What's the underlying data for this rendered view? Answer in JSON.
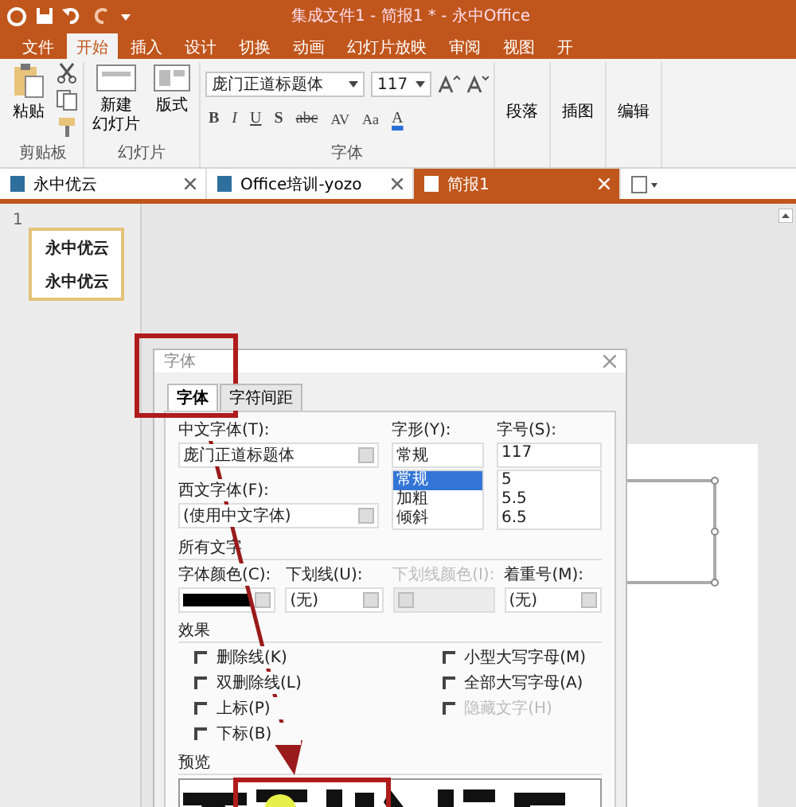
{
  "window": {
    "title": "集成文件1 - 简报1 * - 永中Office"
  },
  "ribbon_tabs": [
    {
      "label": "文件",
      "selected": false
    },
    {
      "label": "开始",
      "selected": true
    },
    {
      "label": "插入",
      "selected": false
    },
    {
      "label": "设计",
      "selected": false
    },
    {
      "label": "切换",
      "selected": false
    },
    {
      "label": "动画",
      "selected": false
    },
    {
      "label": "幻灯片放映",
      "selected": false
    },
    {
      "label": "审阅",
      "selected": false
    },
    {
      "label": "视图",
      "selected": false
    },
    {
      "label": "开",
      "selected": false
    }
  ],
  "clipboard": {
    "label": "剪贴板",
    "paste": "粘贴"
  },
  "slides": {
    "label": "幻灯片",
    "new_slide": [
      "新建",
      "幻灯片"
    ],
    "layout": "版式"
  },
  "font": {
    "label": "字体",
    "name": "庞门正道标题体",
    "size": "117",
    "format_buttons": [
      {
        "label": "B",
        "kind": "bold"
      },
      {
        "label": "I",
        "kind": "italic"
      },
      {
        "label": "U",
        "kind": "underline"
      },
      {
        "label": "S",
        "kind": "shadow"
      },
      {
        "label": "abc",
        "kind": "strike"
      },
      {
        "label": "AV",
        "kind": "spacing"
      },
      {
        "label": "Aa",
        "kind": "case"
      },
      {
        "label": "A",
        "kind": "color"
      }
    ]
  },
  "other_groups": [
    "段落",
    "插图",
    "编辑"
  ],
  "doc_tabs": [
    {
      "label": "永中优云",
      "selected": false
    },
    {
      "label": "Office培训-yozo",
      "selected": false
    },
    {
      "label": "简报1",
      "selected": true
    }
  ],
  "slide_panel": {
    "number": "1",
    "thumbnail_lines": [
      "永中优云",
      "永中优云"
    ]
  },
  "dialog": {
    "title": "字体",
    "tabs": [
      {
        "label": "字体",
        "selected": true
      },
      {
        "label": "字符间距",
        "selected": false
      }
    ],
    "chinese_font": {
      "label": "中文字体(T):",
      "value": "庞门正道标题体"
    },
    "style": {
      "label": "字形(Y):",
      "value": "常规",
      "options": [
        {
          "label": "常规",
          "selected": true
        },
        {
          "label": "加粗",
          "selected": false
        },
        {
          "label": "倾斜",
          "selected": false
        }
      ]
    },
    "size": {
      "label": "字号(S):",
      "value": "117",
      "options": [
        {
          "label": "5",
          "selected": false
        },
        {
          "label": "5.5",
          "selected": false
        },
        {
          "label": "6.5",
          "selected": false
        }
      ]
    },
    "western_font": {
      "label": "西文字体(F):",
      "value": "(使用中文字体)"
    },
    "all_text_heading": "所有文字",
    "font_color": {
      "label": "字体颜色(C):"
    },
    "underline": {
      "label": "下划线(U):",
      "value": "(无)"
    },
    "underline_color": {
      "label": "下划线颜色(I):",
      "disabled": true
    },
    "emphasis": {
      "label": "着重号(M):",
      "value": "(无)"
    },
    "effects_heading": "效果",
    "effects_left": [
      {
        "label": "删除线(K)",
        "checked": false,
        "disabled": false
      },
      {
        "label": "双删除线(L)",
        "checked": false,
        "disabled": false
      },
      {
        "label": "上标(P)",
        "checked": false,
        "disabled": false
      },
      {
        "label": "下标(B)",
        "checked": false,
        "disabled": false
      }
    ],
    "effects_right": [
      {
        "label": "小型大写字母(M)",
        "checked": false,
        "disabled": false
      },
      {
        "label": "全部大写字母(A)",
        "checked": false,
        "disabled": false
      },
      {
        "label": "隐藏文字(H)",
        "checked": false,
        "disabled": true
      }
    ],
    "preview_heading": "预览"
  }
}
